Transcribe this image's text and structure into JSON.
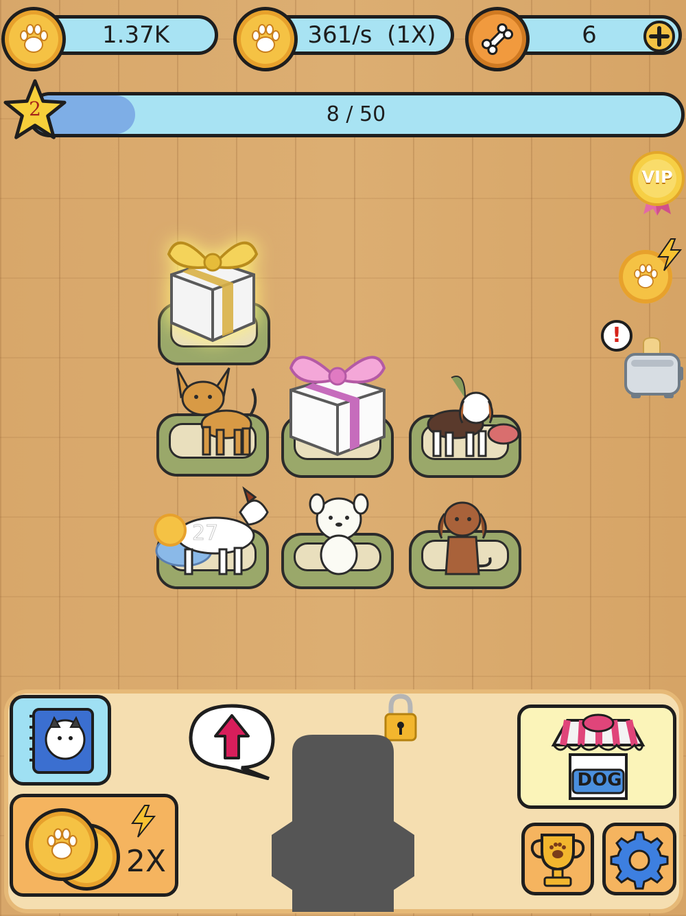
{
  "hud": {
    "coins_value": "1.37K",
    "rate_value": "361/s  (1X)",
    "bones_value": "6",
    "level": "2",
    "progress_text": "8 / 50",
    "progress_fraction": 0.16
  },
  "side_buttons": {
    "vip_label": "VIP",
    "alert_label": "!"
  },
  "bottom": {
    "shop_label": "DOG",
    "boost_label": "2X"
  },
  "colors": {
    "pill_bg": "#a8e3f3",
    "coin": "#f5c244",
    "progress_fill": "#7eaee6",
    "panel_bg": "#f5deb0"
  },
  "icons": [
    "paw-icon",
    "bone-icon",
    "plus-icon",
    "star-icon",
    "vip-badge-icon",
    "lightning-icon",
    "toaster-icon",
    "album-icon",
    "upgrade-arrow-icon",
    "lock-icon",
    "shop-icon",
    "trophy-icon",
    "gear-icon"
  ]
}
